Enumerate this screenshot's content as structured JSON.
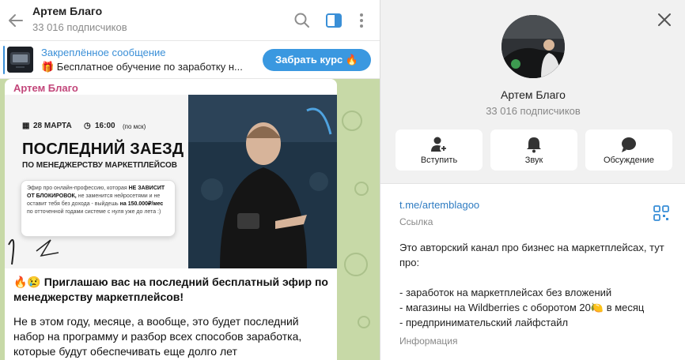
{
  "header": {
    "title": "Артем Благо",
    "subscribers": "33 016 подписчиков"
  },
  "pinned": {
    "title": "Закреплённое сообщение",
    "text": "🎁 Бесплатное обучение по заработку н...",
    "button": "Забрать курс 🔥"
  },
  "message": {
    "author": "Артем Благо",
    "lead": "🔥😢 Приглашаю вас на последний бесплатный эфир по менеджерству маркетплейсов!",
    "body": "Не в этом году, месяце, а вообще, это будет последний набор на программу и разбор всех способов заработка, которые будут обеспечивать еще долго лет",
    "banner": {
      "date": "28 МАРТА",
      "time": "16:00",
      "time_zone": "(по мск)",
      "title": "ПОСЛЕДНИЙ ЗАЕЗД",
      "subtitle": "ПО МЕНЕДЖЕРСТВУ МАРКЕТПЛЕЙСОВ",
      "card_1": "Эфир про онлайн-профессию, которая",
      "card_2": "НЕ ЗАВИСИТ ОТ БЛОКИРОВОК,",
      "card_3": "не заменится нейросетями и не оставит тебя без дохода - выйдешь",
      "card_4": "на 150.000₽/мес",
      "card_5": "по отточенной годами системе с нуля уже до лета :)"
    }
  },
  "profile": {
    "name": "Артем Благо",
    "subscribers": "33 016 подписчиков",
    "actions": [
      {
        "label": "Вступить",
        "icon": "add-user-icon"
      },
      {
        "label": "Звук",
        "icon": "bell-icon"
      },
      {
        "label": "Обсуждение",
        "icon": "chat-bubble-icon"
      }
    ],
    "link": "t.me/artemblagoo",
    "link_label": "Ссылка",
    "description": [
      "Это авторский канал про бизнес на маркетплейсах, тут про:",
      "- заработок на маркетплейсах без вложений",
      "- магазины на Wildberries с оборотом 20🍋 в месяц",
      "- предпринимательский лайфстайл"
    ],
    "info_label": "Информация"
  },
  "colors": {
    "accent": "#3a8fd7",
    "author": "#c2467a",
    "chat_bg": "#c7d9a7",
    "panel_bg": "#f1f1f1"
  }
}
